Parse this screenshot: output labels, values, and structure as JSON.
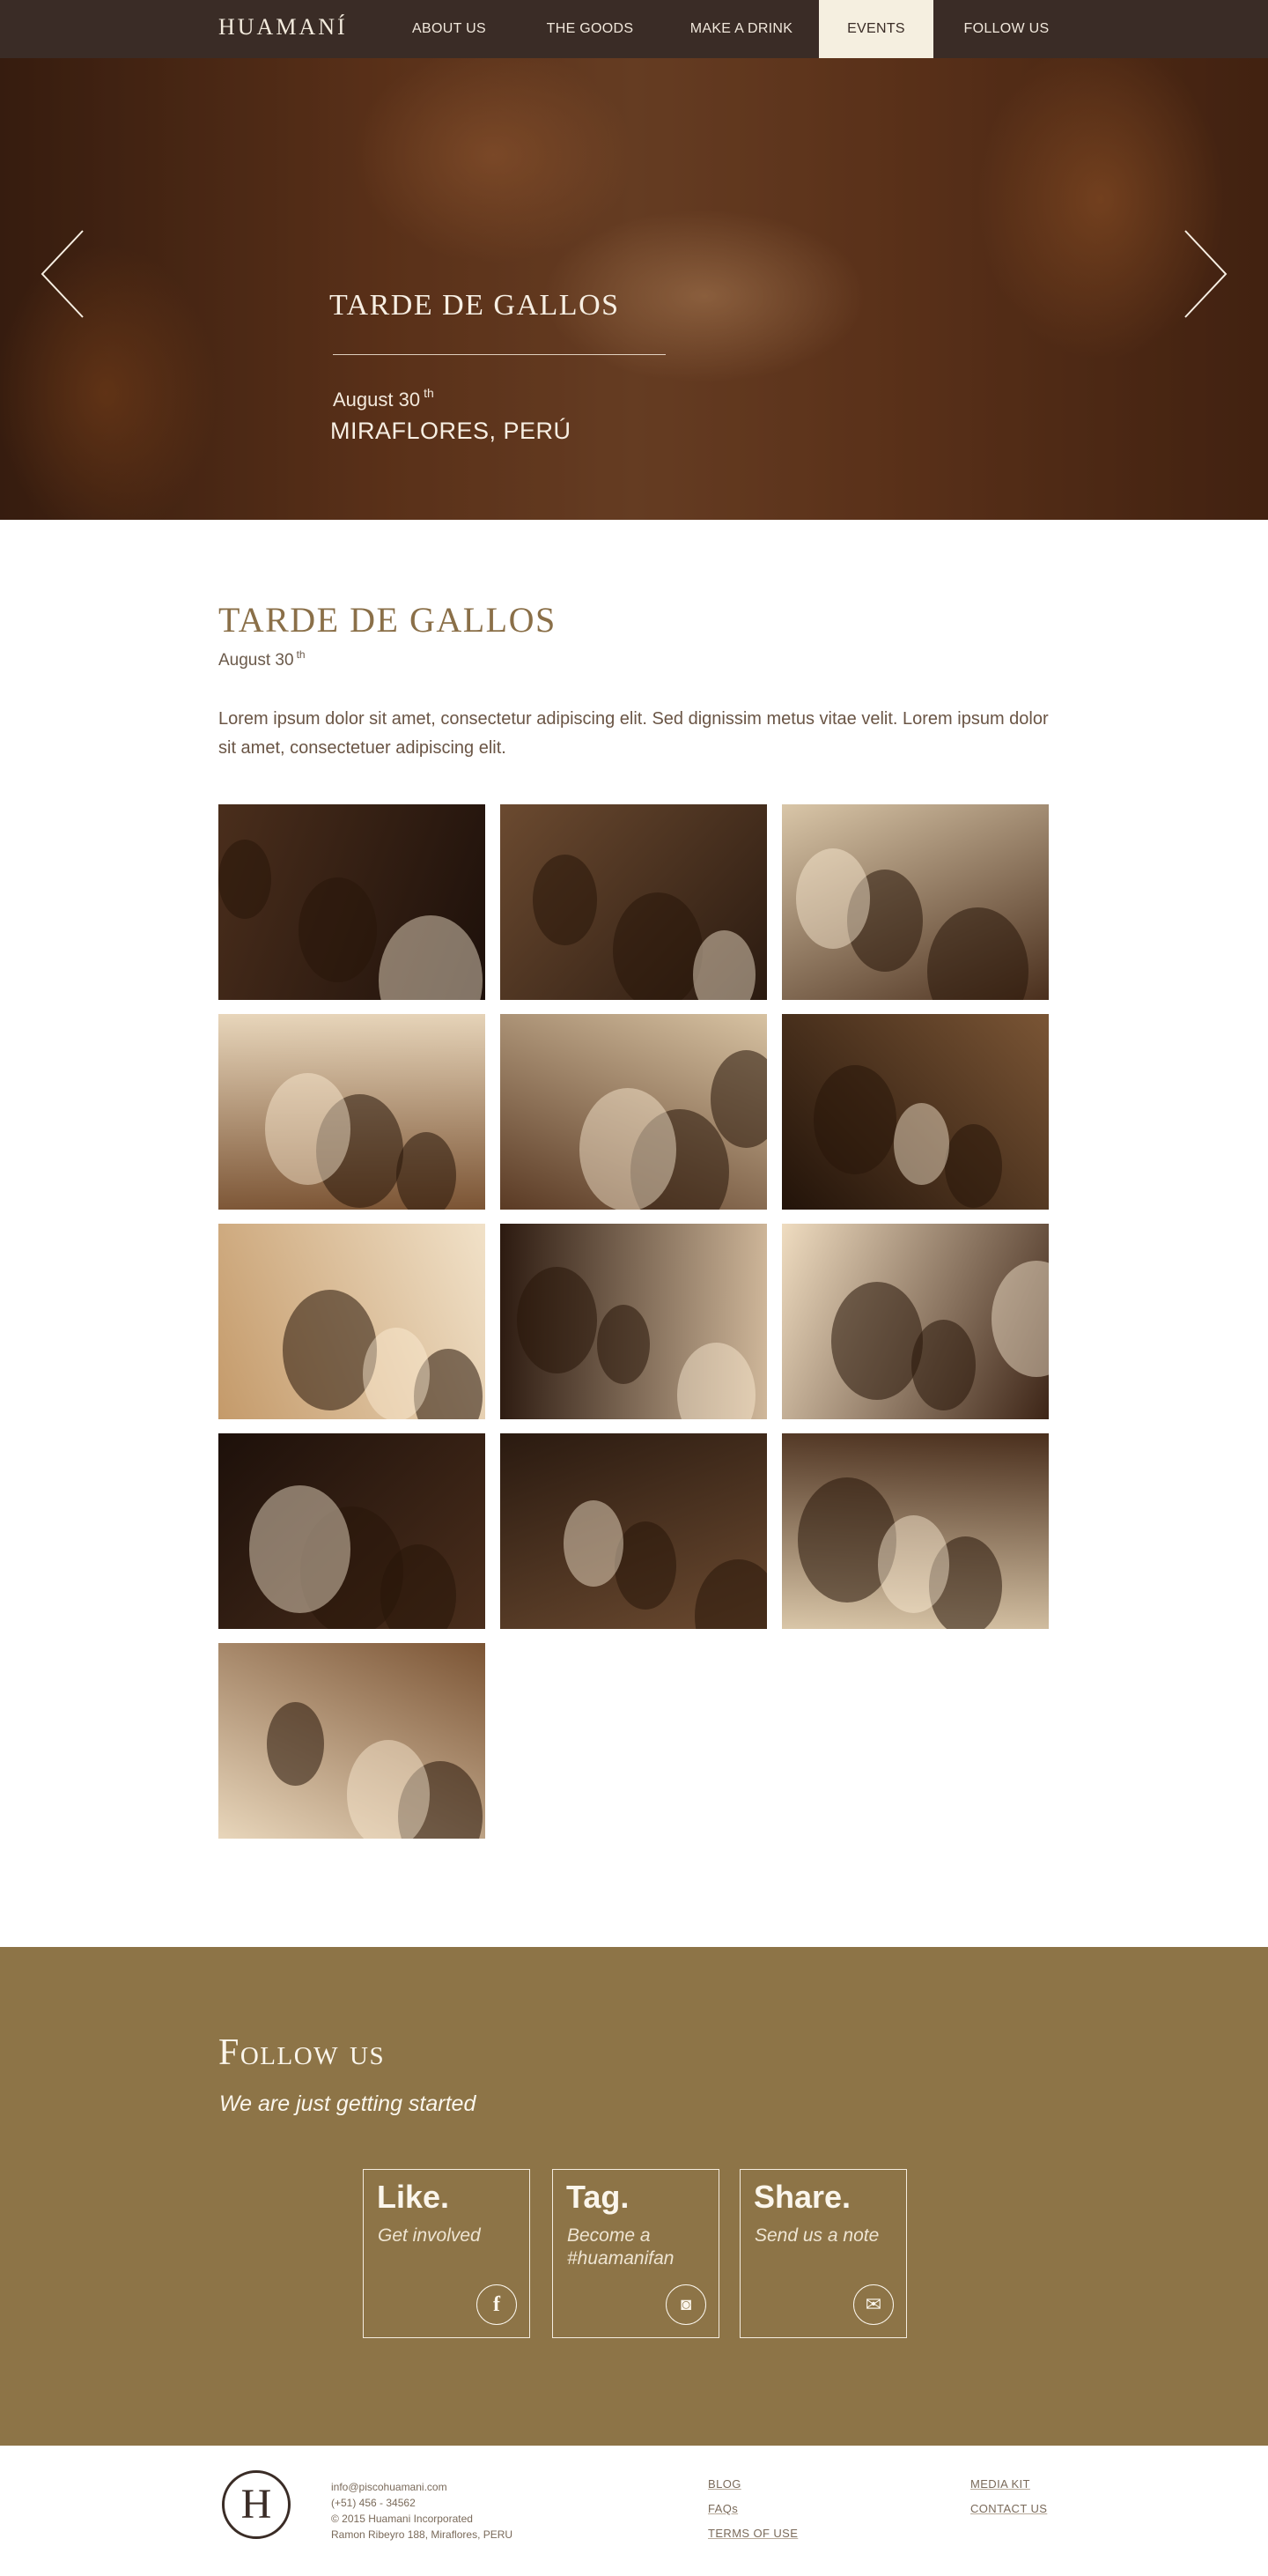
{
  "nav": {
    "logo": "HUAMANÍ",
    "items": [
      {
        "label": "ABOUT US",
        "active": false
      },
      {
        "label": "THE GOODS",
        "active": false
      },
      {
        "label": "MAKE A DRINK",
        "active": false
      },
      {
        "label": "EVENTS",
        "active": true
      },
      {
        "label": "FOLLOW US",
        "active": false
      }
    ]
  },
  "hero": {
    "title": "TARDE DE GALLOS",
    "date": "August 30",
    "date_suffix": "th",
    "place": "MIRAFLORES, PERÚ",
    "prev_icon": "chevron-left-icon",
    "next_icon": "chevron-right-icon"
  },
  "event": {
    "title": "TARDE DE GALLOS",
    "date": "August 30",
    "date_suffix": "th",
    "description": "Lorem ipsum dolor sit amet, consectetur adipiscing elit. Sed dignissim metus vitae velit. Lorem ipsum dolor sit amet, consectetuer adipiscing elit."
  },
  "gallery": {
    "photos": [
      "arena-wall-sign",
      "friends-with-hats",
      "woman-with-hat",
      "group-selfie",
      "couple-smiling",
      "cockfight-arena",
      "pisco-bottle",
      "men-talking",
      "crowd-conversation",
      "group-selfie",
      "couple-smiling",
      "cockfight-arena",
      "pisco-bottle"
    ]
  },
  "follow": {
    "title": "Follow us",
    "subtitle": "We are just getting started",
    "cards": [
      {
        "title": "Like.",
        "subtitle": "Get involved",
        "icon": "facebook-icon",
        "glyph": "f"
      },
      {
        "title": "Tag.",
        "subtitle": "Become a #huamanifan",
        "icon": "instagram-icon",
        "glyph": "◙"
      },
      {
        "title": "Share.",
        "subtitle": "Send us a note",
        "icon": "mail-icon",
        "glyph": "✉"
      }
    ]
  },
  "footer": {
    "monogram": "H",
    "email": "info@piscohuamani.com",
    "phone": "(+51) 456 - 34562",
    "copyright": "© 2015 Huamani Incorporated",
    "address": "Ramon Ribeyro 188, Miraflores, PERU",
    "links_col1": [
      "BLOG",
      "FAQs",
      "TERMS OF USE"
    ],
    "links_col2": [
      "MEDIA KIT",
      "CONTACT US"
    ]
  },
  "colors": {
    "nav_bg": "#3a2c26",
    "active_tab": "#f5efe0",
    "accent_gold": "#8a6f48",
    "follow_bg": "#8d7447"
  }
}
